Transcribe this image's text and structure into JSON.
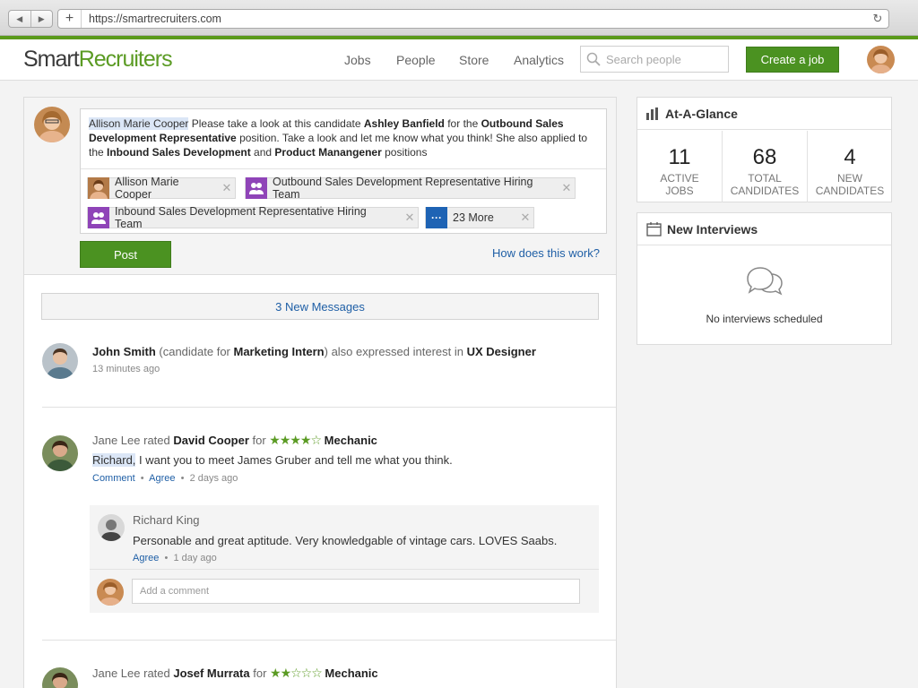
{
  "browser": {
    "url": "https://smartrecruiters.com"
  },
  "header": {
    "logo_smart": "Smart",
    "logo_recruiters": "Recruiters",
    "nav": [
      "Jobs",
      "People",
      "Store",
      "Analytics"
    ],
    "search_placeholder": "Search people",
    "create_job": "Create a job"
  },
  "composer": {
    "mention": "Allison Marie Cooper",
    "text1": " Please take a look at this candidate ",
    "candidate": "Ashley Banfield",
    "text2": " for the ",
    "position": "Outbound Sales Development Representative",
    "text3": " position. Take a look and let me know what you think! She also applied to the ",
    "position2": "Inbound Sales Development",
    "text4": " and ",
    "position3": "Product Manangener",
    "text5": " positions",
    "tags": [
      "Allison Marie Cooper",
      "Outbound Sales Development Representative Hiring Team",
      "Inbound Sales Development Representative Hiring Team",
      "23 More"
    ],
    "post": "Post",
    "how": "How does this work?"
  },
  "new_messages": "3 New Messages",
  "feed": [
    {
      "name": "John Smith",
      "pre": " (candidate for ",
      "job": "Marketing Intern",
      "mid": ") also expressed interest in ",
      "job2": "UX Designer",
      "time": "13 minutes ago"
    },
    {
      "actor": "Jane Lee",
      "verb": " rated ",
      "name": "David Cooper",
      "for": " for ",
      "stars": "★★★★☆",
      "job": "Mechanic",
      "mention": "Richard,",
      "message": " I want you to meet James Gruber and tell me what you think.",
      "comment": "Comment",
      "agree": "Agree",
      "time": "2 days ago",
      "reply": {
        "name": "Richard King",
        "text": "Personable and great aptitude. Very knowledgable of vintage cars. LOVES Saabs.",
        "agree": "Agree",
        "time": "1 day ago"
      },
      "add_comment": "Add a comment"
    },
    {
      "actor": "Jane Lee",
      "verb": " rated ",
      "name": "Josef Murrata",
      "for": " for ",
      "stars": "★★☆☆☆",
      "job": "Mechanic"
    }
  ],
  "glance": {
    "title": "At-A-Glance",
    "stats": [
      {
        "num": "11",
        "l1": "ACTIVE",
        "l2": "JOBS"
      },
      {
        "num": "68",
        "l1": "TOTAL",
        "l2": "CANDIDATES"
      },
      {
        "num": "4",
        "l1": "NEW",
        "l2": "CANDIDATES"
      }
    ]
  },
  "interviews": {
    "title": "New Interviews",
    "empty": "No interviews scheduled"
  },
  "colors": {
    "brand_green": "#4b9221",
    "link_blue": "#1f5fa6"
  }
}
